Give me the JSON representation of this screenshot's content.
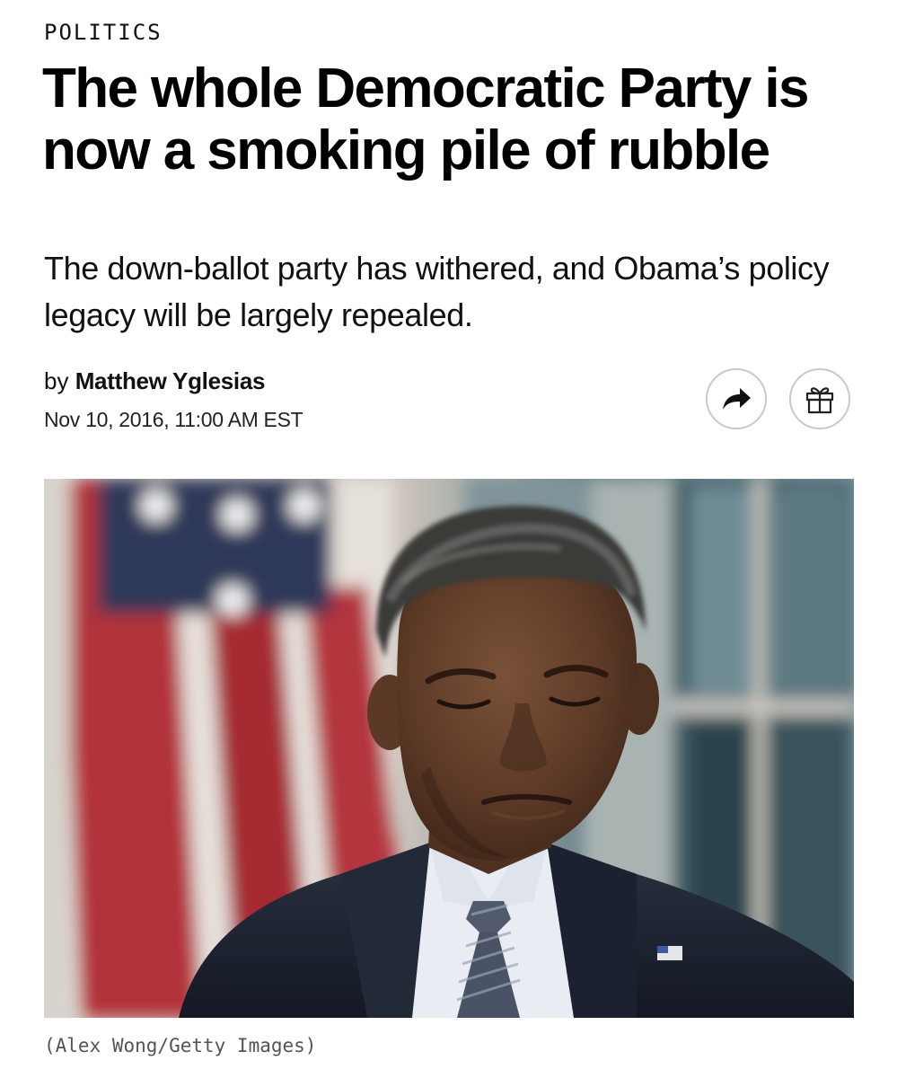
{
  "article": {
    "section": "POLITICS",
    "headline": "The whole Democratic Party is now a smoking pile of rubble",
    "dek": "The down-ballot party has withered, and Obama’s policy legacy will be largely repealed.",
    "byline_prefix": "by",
    "author": "Matthew Yglesias",
    "timestamp": "Nov 10, 2016, 11:00 AM EST",
    "photo_caption": "(Alex Wong/Getty Images)"
  },
  "icons": {
    "share": "share-arrow-icon",
    "gift": "gift-icon"
  },
  "colors": {
    "text": "#000000",
    "button_border": "#c9c9c9",
    "caption": "#555555"
  }
}
